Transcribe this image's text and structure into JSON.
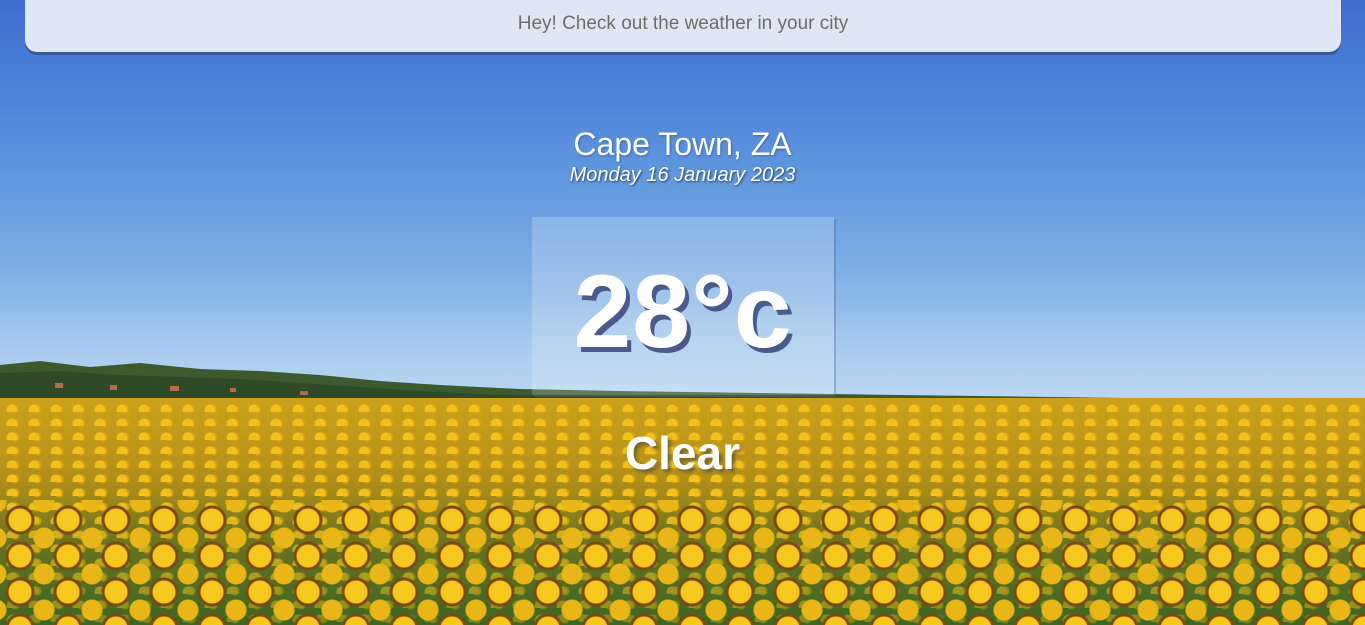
{
  "header": {
    "tagline": "Hey! Check out the weather in your city"
  },
  "location": {
    "city_country": "Cape Town, ZA",
    "date": "Monday 16 January 2023"
  },
  "weather": {
    "temperature": "28°c",
    "condition": "Clear"
  },
  "colors": {
    "header_bg": "#dfe7f5",
    "header_border": "#3a57a0",
    "text_primary": "#ffffff",
    "tagline_text": "#6d6d6d"
  },
  "background": {
    "scene": "sunflower-field-under-blue-sky"
  }
}
